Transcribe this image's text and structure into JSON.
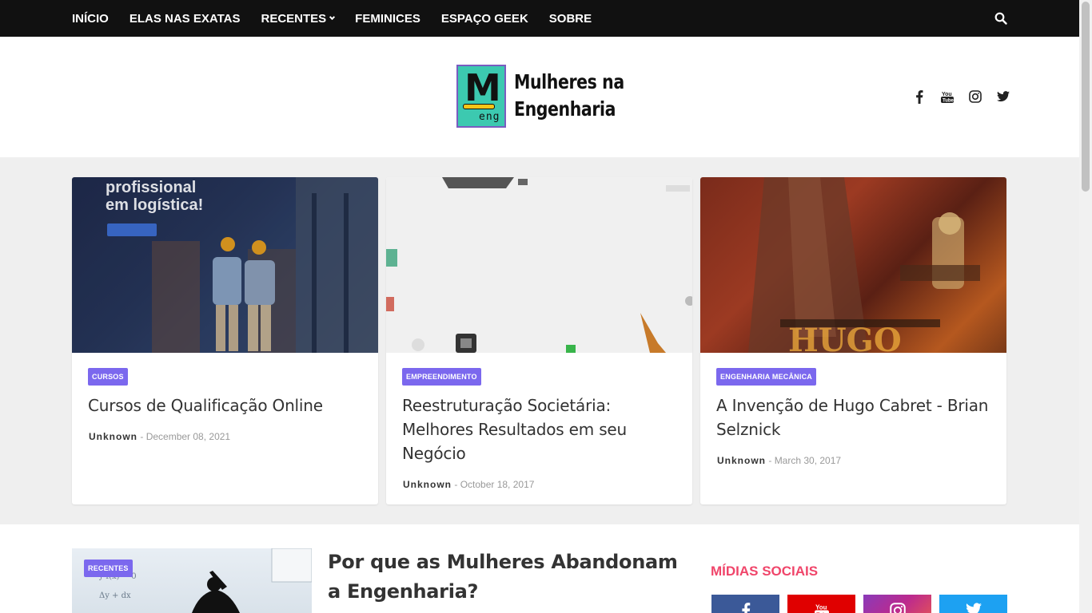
{
  "nav": {
    "items": [
      {
        "label": "INÍCIO"
      },
      {
        "label": "ELAS NAS EXATAS"
      },
      {
        "label": "RECENTES"
      },
      {
        "label": "FEMINICES"
      },
      {
        "label": "ESPAÇO GEEK"
      },
      {
        "label": "SOBRE"
      }
    ],
    "search_icon": "search-icon"
  },
  "header": {
    "logo": {
      "mark_letter": "M",
      "mark_sub": "eng",
      "line1": "Mulheres na",
      "line2": "Engenharia"
    },
    "social_icons": [
      "facebook-icon",
      "youtube-icon",
      "instagram-icon",
      "twitter-icon"
    ]
  },
  "featured": [
    {
      "category": "CURSOS",
      "title": "Cursos de Qualificação Online",
      "author": "Unknown",
      "date": "December 08, 2021",
      "image_text_1": "profissional",
      "image_text_2": "em logística!"
    },
    {
      "category": "EMPREENDIMENTO",
      "title": "Reestruturação Societária: Melhores Resultados em seu Negócio",
      "author": "Unknown",
      "date": "October 18, 2017"
    },
    {
      "category": "ENGENHARIA MECÂNICA",
      "title": "A Invenção de Hugo Cabret - Brian Selznick",
      "author": "Unknown",
      "date": "March 30, 2017"
    }
  ],
  "recent_post": {
    "category": "RECENTES",
    "title": "Por que as Mulheres Abandonam a Engenharia?"
  },
  "sidebar": {
    "widget_title": "MÍDIAS SOCIAIS",
    "buttons": [
      {
        "icon": "facebook-icon",
        "color": "#3b5998"
      },
      {
        "icon": "youtube-icon",
        "color": "#e00000"
      },
      {
        "icon": "instagram-icon",
        "color": "#a42fbc"
      },
      {
        "icon": "twitter-icon",
        "color": "#1da1f2"
      }
    ]
  },
  "colors": {
    "badge": "#7b68ee",
    "nav_bg": "#111111",
    "widget_title": "#f0456a"
  }
}
